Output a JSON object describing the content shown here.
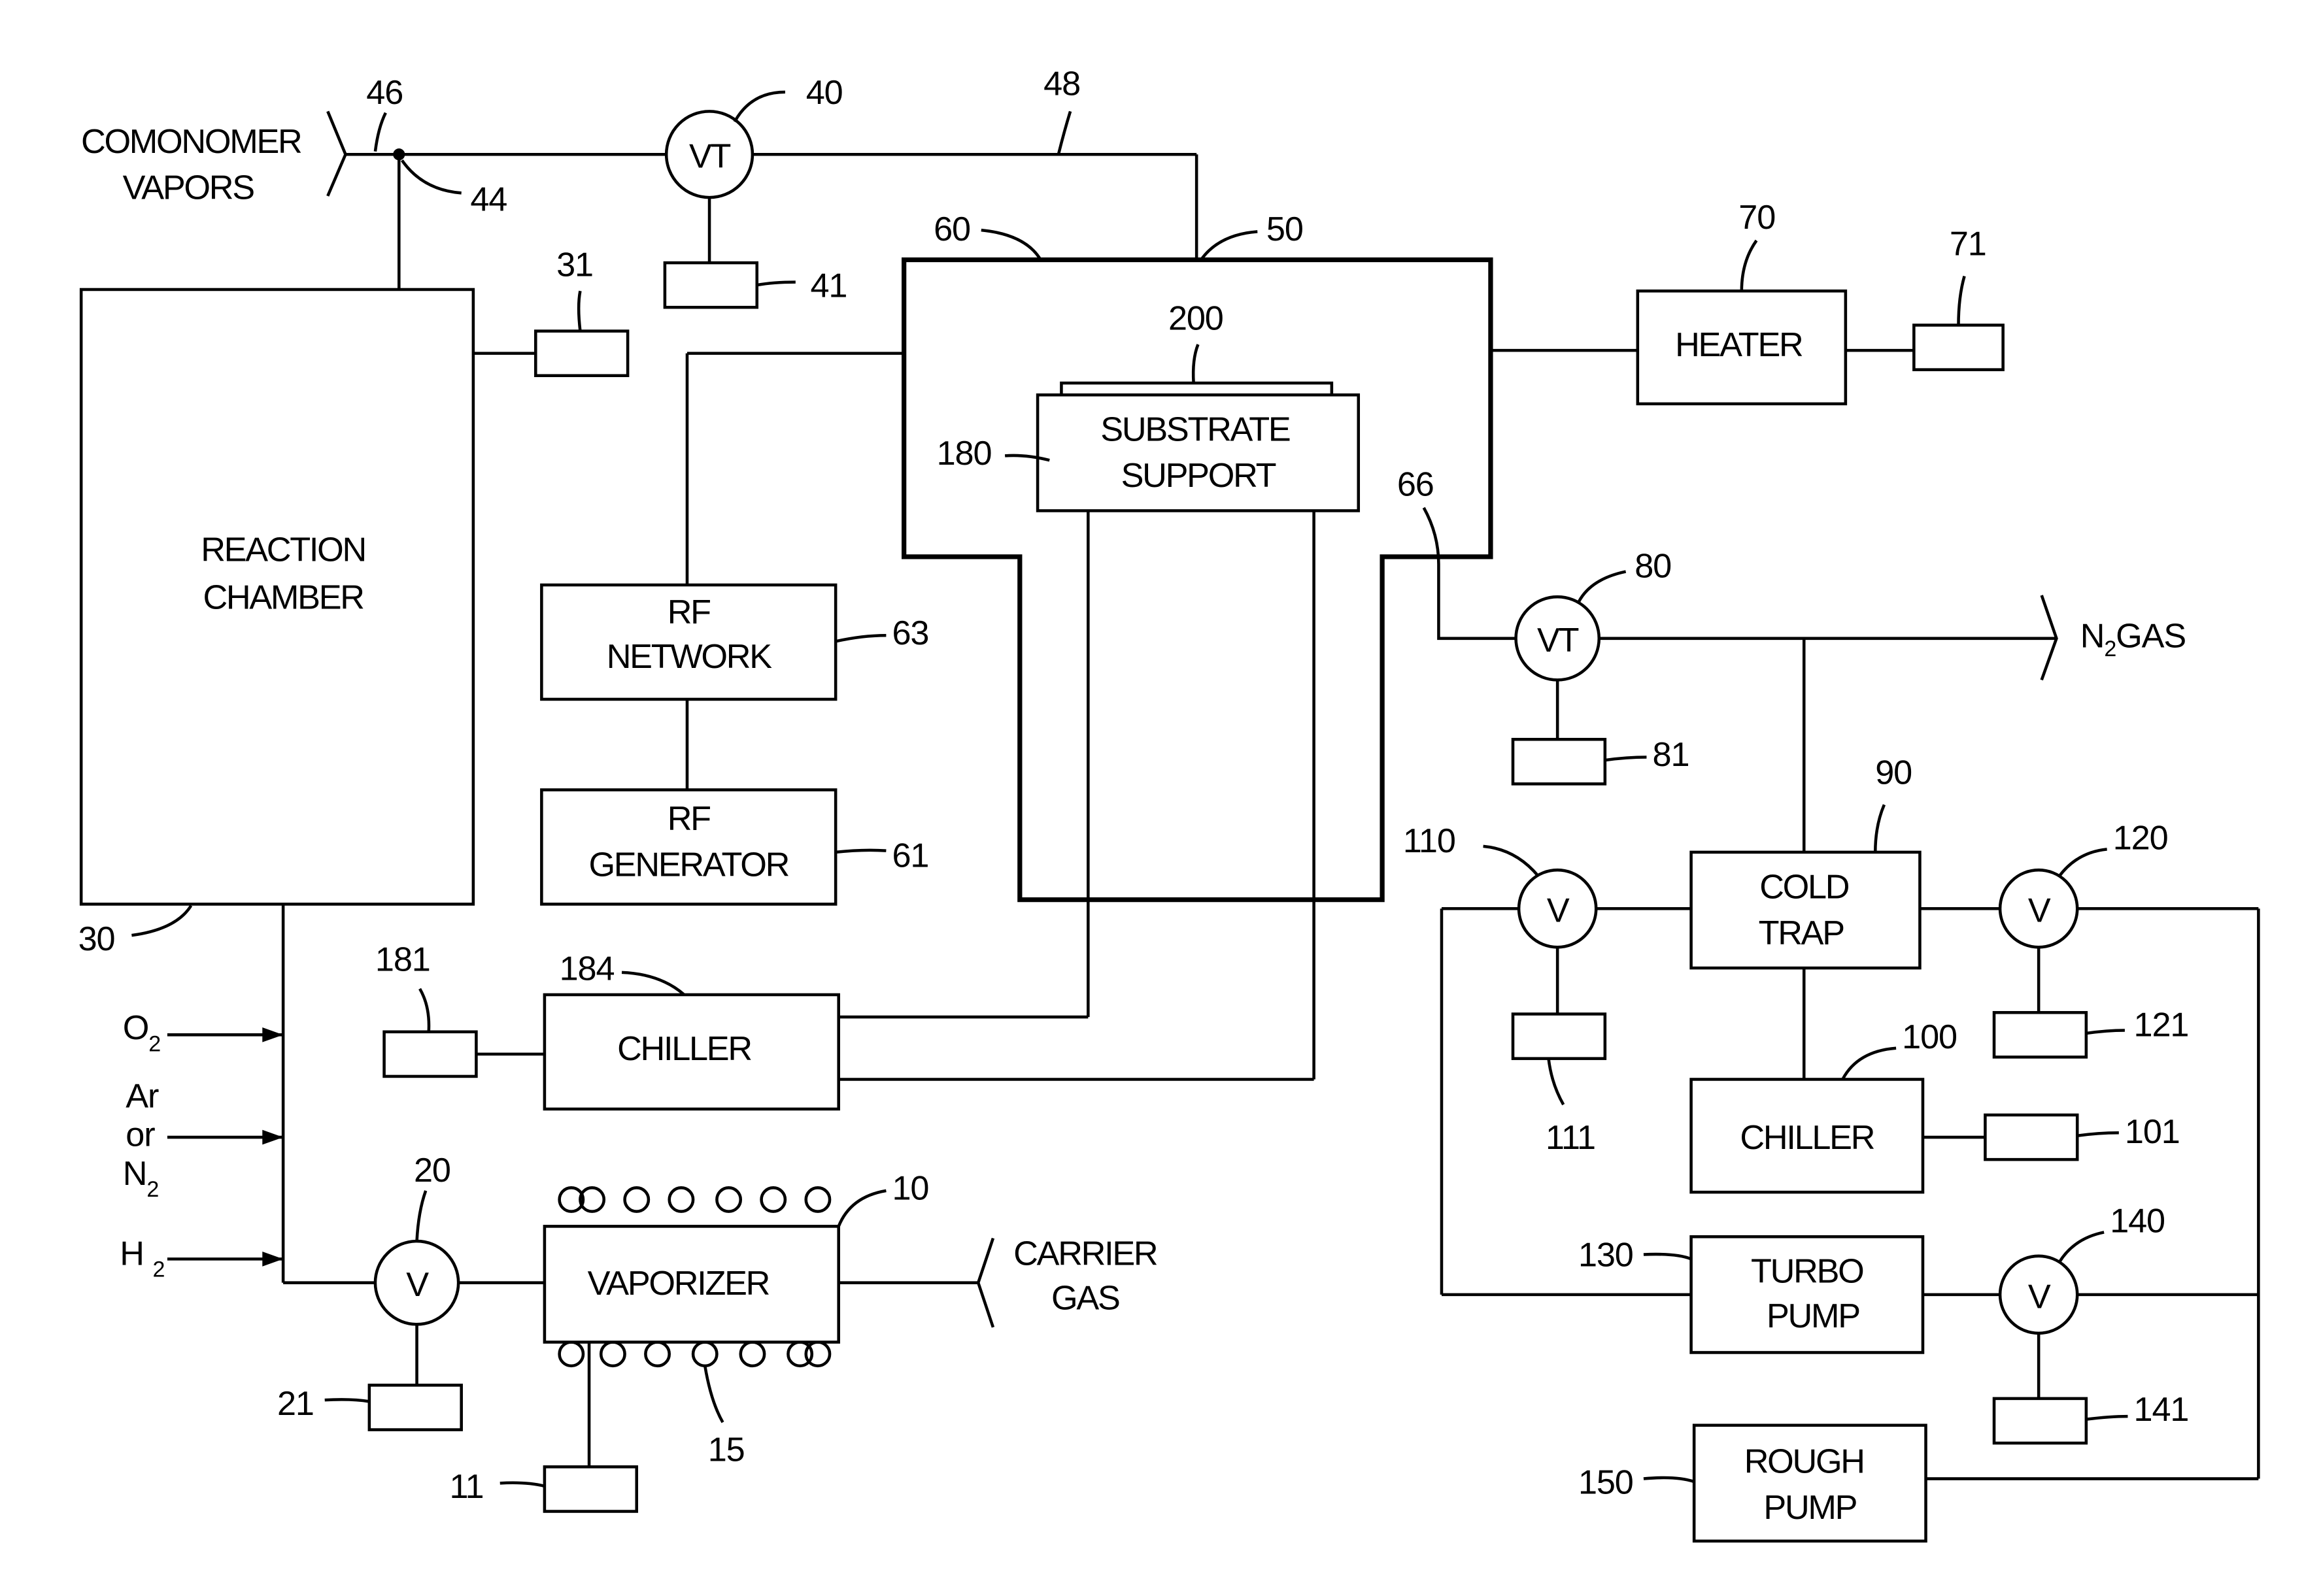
{
  "figure": {
    "components": {
      "reaction_chamber": {
        "line1": "REACTION",
        "line2": "CHAMBER",
        "ref": "30"
      },
      "substrate_support": {
        "line1": "SUBSTRATE",
        "line2": "SUPPORT",
        "ref": "180"
      },
      "substrate": {
        "ref": "200"
      },
      "process_chamber": {
        "ref_wall": "60",
        "ref_inlet": "50",
        "ref_outlet": "66"
      },
      "rf_network": {
        "line1": "RF",
        "line2": "NETWORK",
        "ref": "63"
      },
      "rf_generator": {
        "line1": "RF",
        "line2": "GENERATOR",
        "ref": "61"
      },
      "chiller_left": {
        "label": "CHILLER",
        "ref": "184"
      },
      "heater": {
        "label": "HEATER",
        "ref": "70"
      },
      "vaporizer": {
        "label": "VAPORIZER",
        "ref": "10",
        "coil_ref": "15"
      },
      "cold_trap": {
        "line1": "COLD",
        "line2": "TRAP",
        "ref": "90"
      },
      "chiller_right": {
        "label": "CHILLER",
        "ref": "100"
      },
      "turbo_pump": {
        "line1": "TURBO",
        "line2": "PUMP",
        "ref": "130"
      },
      "rough_pump": {
        "line1": "ROUGH",
        "line2": "PUMP",
        "ref": "150"
      }
    },
    "valves": {
      "vt40": {
        "symbol": "VT",
        "ref": "40"
      },
      "vt80": {
        "symbol": "VT",
        "ref": "80"
      },
      "v20": {
        "symbol": "V",
        "ref": "20"
      },
      "v110": {
        "symbol": "V",
        "ref": "110"
      },
      "v120": {
        "symbol": "V",
        "ref": "120"
      },
      "v140": {
        "symbol": "V",
        "ref": "140"
      }
    },
    "controllers": {
      "c31": "31",
      "c41": "41",
      "c71": "71",
      "c81": "81",
      "c181": "181",
      "c21": "21",
      "c11": "11",
      "c111": "111",
      "c121": "121",
      "c101": "101",
      "c141": "141"
    },
    "refs": {
      "junction": "44",
      "inlet": "46",
      "line": "48"
    },
    "gas_inputs": {
      "comonomer_line1": "COMONOMER",
      "comonomer_line2": "VAPORS",
      "o2": "O",
      "o2_sub": "2",
      "ar": "Ar",
      "or": "or",
      "n2": "N",
      "n2_sub": "2",
      "h2": "H",
      "h2_sub": "2",
      "carrier_line1": "CARRIER",
      "carrier_line2": "GAS",
      "n2gas_prefix": "N",
      "n2gas_sub": "2",
      "n2gas_suffix": "GAS"
    }
  }
}
